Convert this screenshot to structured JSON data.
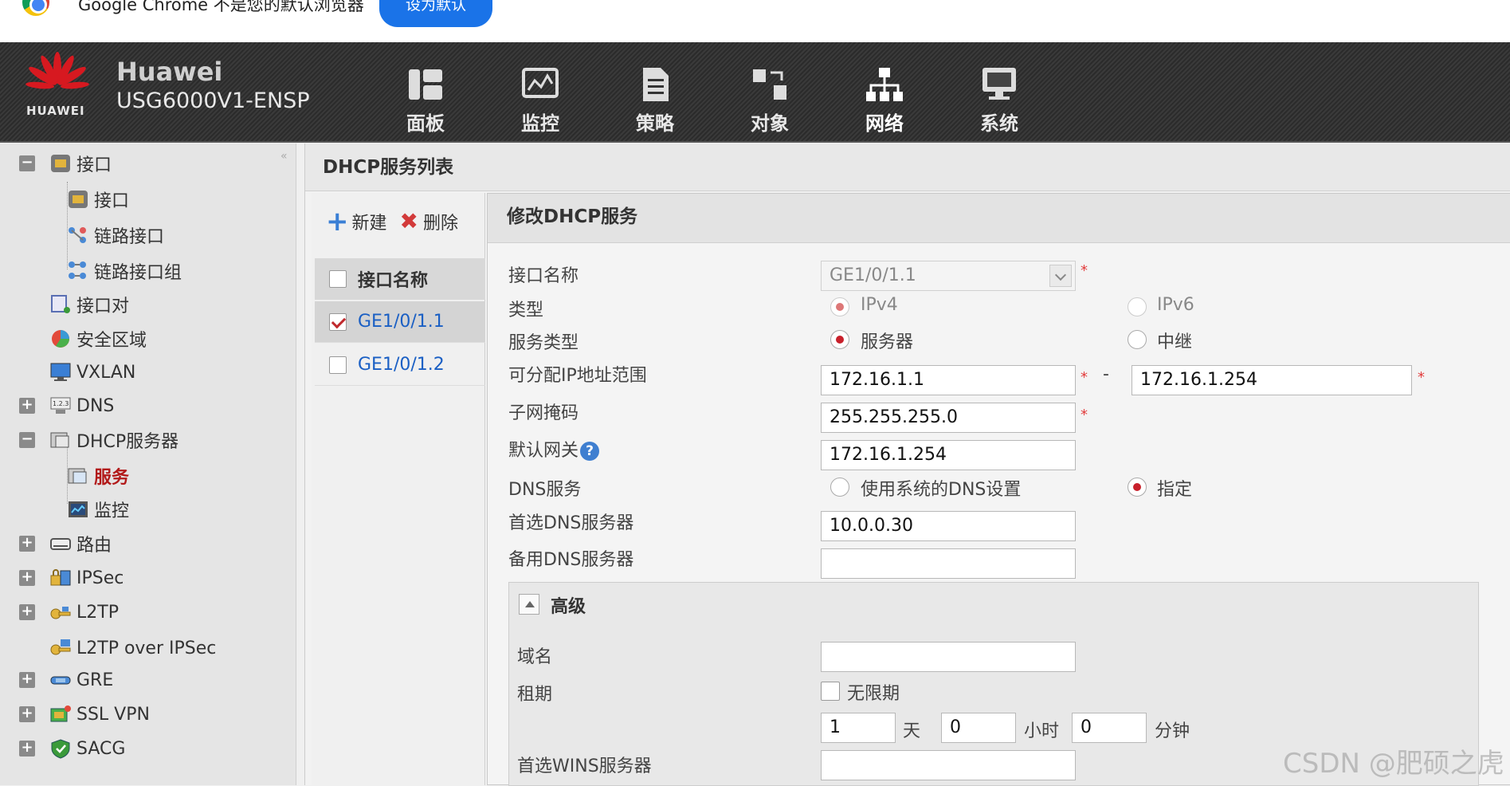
{
  "chrome_notice": {
    "text": "Google Chrome 不是您的默认浏览器",
    "button": "设为默认"
  },
  "header": {
    "brand": "HUAWEI",
    "product_name": "Huawei",
    "product_model": "USG6000V1-ENSP",
    "nav": [
      {
        "label": "面板",
        "icon": "dashboard-icon"
      },
      {
        "label": "监控",
        "icon": "monitor-icon"
      },
      {
        "label": "策略",
        "icon": "policy-icon"
      },
      {
        "label": "对象",
        "icon": "object-icon"
      },
      {
        "label": "网络",
        "icon": "network-icon",
        "active": true
      },
      {
        "label": "系统",
        "icon": "system-icon"
      }
    ]
  },
  "sidebar": {
    "items": [
      {
        "label": "接口",
        "toggle": "−"
      },
      {
        "label": "接口"
      },
      {
        "label": "链路接口"
      },
      {
        "label": "链路接口组"
      },
      {
        "label": "接口对"
      },
      {
        "label": "安全区域"
      },
      {
        "label": "VXLAN"
      },
      {
        "label": "DNS",
        "toggle": "+"
      },
      {
        "label": "DHCP服务器",
        "toggle": "−"
      },
      {
        "label": "服务",
        "selected": true
      },
      {
        "label": "监控"
      },
      {
        "label": "路由",
        "toggle": "+"
      },
      {
        "label": "IPSec",
        "toggle": "+"
      },
      {
        "label": "L2TP",
        "toggle": "+"
      },
      {
        "label": "L2TP over IPSec"
      },
      {
        "label": "GRE",
        "toggle": "+"
      },
      {
        "label": "SSL VPN",
        "toggle": "+"
      },
      {
        "label": "SACG",
        "toggle": "+"
      }
    ]
  },
  "main": {
    "title": "DHCP服务列表",
    "toolbar": {
      "new": "新建",
      "delete": "删除"
    },
    "list": {
      "header": "接口名称",
      "rows": [
        {
          "name": "GE1/0/1.1",
          "checked": true
        },
        {
          "name": "GE1/0/1.2",
          "checked": false
        }
      ]
    }
  },
  "form": {
    "title": "修改DHCP服务",
    "interface_label": "接口名称",
    "interface_value": "GE1/0/1.1",
    "type_label": "类型",
    "type_ipv4": "IPv4",
    "type_ipv6": "IPv6",
    "service_type_label": "服务类型",
    "service_server": "服务器",
    "service_relay": "中继",
    "ip_range_label": "可分配IP地址范围",
    "ip_range_start": "172.16.1.1",
    "ip_range_sep": "-",
    "ip_range_end": "172.16.1.254",
    "mask_label": "子网掩码",
    "mask_value": "255.255.255.0",
    "gateway_label": "默认网关",
    "gateway_value": "172.16.1.254",
    "dns_label": "DNS服务",
    "dns_system": "使用系统的DNS设置",
    "dns_specify": "指定",
    "dns_primary_label": "首选DNS服务器",
    "dns_primary_value": "10.0.0.30",
    "dns_secondary_label": "备用DNS服务器",
    "dns_secondary_value": "",
    "advanced": {
      "title": "高级",
      "domain_label": "域名",
      "domain_value": "",
      "lease_label": "租期",
      "lease_unlimited": "无限期",
      "lease_days": "1",
      "lease_days_unit": "天",
      "lease_hours": "0",
      "lease_hours_unit": "小时",
      "lease_minutes": "0",
      "lease_minutes_unit": "分钟",
      "wins_label": "首选WINS服务器",
      "wins_value": ""
    }
  },
  "watermark": "CSDN @肥硕之虎"
}
